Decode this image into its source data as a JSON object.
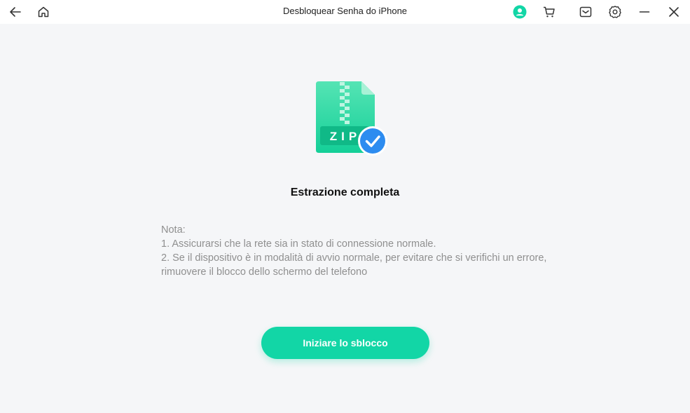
{
  "window": {
    "title": "Desbloquear Senha do iPhone"
  },
  "titlebar": {
    "icons": [
      "back-icon",
      "home-icon",
      "user-icon",
      "cart-icon",
      "mail-icon",
      "gear-icon",
      "minimize-icon",
      "close-icon"
    ]
  },
  "main": {
    "zip_label": "ZIP",
    "heading": "Estrazione completa",
    "note_title": "Nota:",
    "note_lines": [
      "1. Assicurarsi che la rete sia in stato di connessione normale.",
      "2. Se il dispositivo è in modalità di avvio normale, per evitare che si verifichi un errore, rimuovere il blocco dello schermo del telefono"
    ],
    "start_button": "Iniziare lo sblocco"
  },
  "colors": {
    "accent": "#12d6a6",
    "check_badge": "#2d8cf0",
    "background": "#f5f6f8"
  }
}
